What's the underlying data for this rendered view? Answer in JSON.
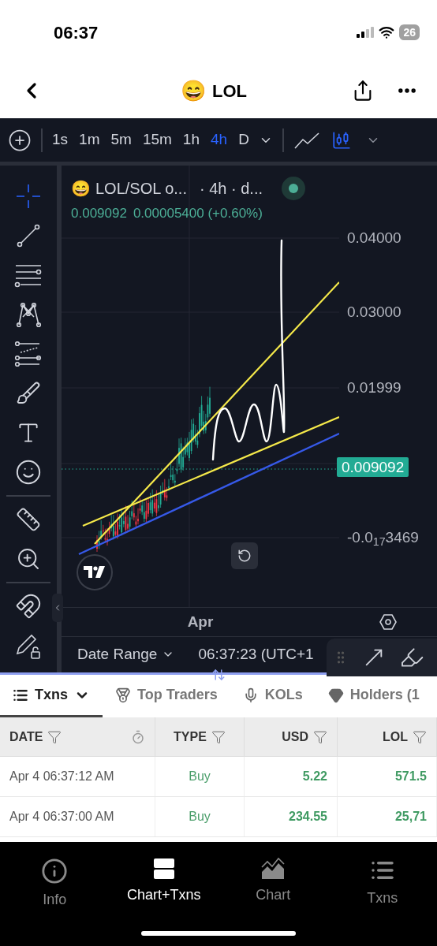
{
  "status_bar": {
    "time": "06:37",
    "battery": "26"
  },
  "nav": {
    "emoji": "😄",
    "title": "LOL"
  },
  "toolbar": {
    "intervals": [
      {
        "label": "1s",
        "selected": false
      },
      {
        "label": "1m",
        "selected": false
      },
      {
        "label": "5m",
        "selected": false
      },
      {
        "label": "15m",
        "selected": false
      },
      {
        "label": "1h",
        "selected": false
      },
      {
        "label": "4h",
        "selected": true
      },
      {
        "label": "D",
        "selected": false
      }
    ],
    "chart_styles": [
      {
        "selected": false
      },
      {
        "selected": true
      }
    ]
  },
  "drawing_tools": [
    {
      "selected": true
    },
    {
      "selected": false
    },
    {
      "selected": false
    },
    {
      "selected": false
    },
    {
      "selected": false
    },
    {
      "selected": false
    },
    {
      "selected": false
    },
    {
      "selected": false
    },
    {
      "selected": false
    },
    {
      "selected": false
    },
    {
      "selected": false
    },
    {
      "selected": false
    }
  ],
  "legend": {
    "emoji": "😄",
    "symbol": "LOL/SOL o...",
    "interval": "· 4h · d...",
    "price": "0.009092",
    "change": "0.00005400 (+0.60%)"
  },
  "price_axis": [
    "0.04000",
    "0.03000",
    "0.01999",
    "-0.0$_{17}$3469"
  ],
  "last_price": "0.009092",
  "time_axis": [
    "Apr"
  ],
  "bottom_bar": {
    "date_range": "Date Range",
    "clock": "06:37:23 (UTC+1"
  },
  "tabs": [
    {
      "label": "Txns",
      "selected": true
    },
    {
      "label": "Top Traders",
      "selected": false
    },
    {
      "label": "KOLs",
      "selected": false
    },
    {
      "label": "Holders (1",
      "selected": false
    }
  ],
  "table": {
    "columns": [
      "DATE",
      "TYPE",
      "USD",
      "LOL"
    ],
    "rows": [
      [
        "Apr 4 06:37:12 AM",
        "Buy",
        "5.22",
        "571.5"
      ],
      [
        "Apr 4 06:37:00 AM",
        "Buy",
        "234.55",
        "25,71"
      ]
    ]
  },
  "bottom_nav": [
    {
      "label": "Info",
      "selected": false
    },
    {
      "label": "Chart+Txns",
      "selected": true
    },
    {
      "label": "Chart",
      "selected": false
    },
    {
      "label": "Txns",
      "selected": false
    }
  ]
}
